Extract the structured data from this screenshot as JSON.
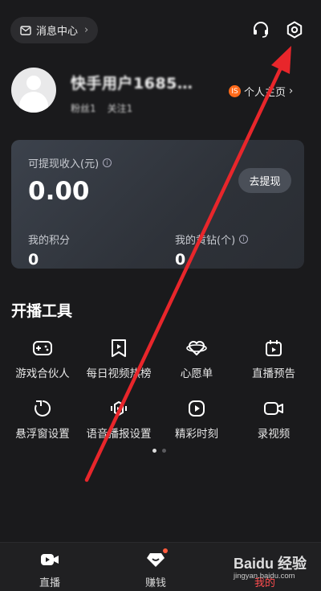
{
  "header": {
    "message_center": "消息中心",
    "message_chevron": "›",
    "icons": [
      "envelope-icon",
      "headset-icon",
      "settings-icon"
    ]
  },
  "profile": {
    "username": "快手用户1685…",
    "stats": [
      "粉丝1",
      "关注1"
    ],
    "homepage_label": "个人主页",
    "homepage_chevron": "›",
    "badge_text": "IS"
  },
  "wallet": {
    "income_label": "可提现收入(元)",
    "income_value": "0.00",
    "withdraw_label": "去提现",
    "points_label": "我的积分",
    "points_value": "0",
    "diamond_label": "我的黄钻(个)",
    "diamond_value": "0"
  },
  "tools": {
    "title": "开播工具",
    "items": [
      {
        "label": "游戏合伙人",
        "icon": "gamepad-icon"
      },
      {
        "label": "每日视频热榜",
        "icon": "bookmark-play-icon"
      },
      {
        "label": "心愿单",
        "icon": "heart-ring-icon"
      },
      {
        "label": "直播预告",
        "icon": "calendar-play-icon"
      },
      {
        "label": "悬浮窗设置",
        "icon": "floating-window-icon"
      },
      {
        "label": "语音播报设置",
        "icon": "voice-broadcast-icon"
      },
      {
        "label": "精彩时刻",
        "icon": "highlight-play-icon"
      },
      {
        "label": "录视频",
        "icon": "video-record-icon"
      }
    ],
    "page_indicator": {
      "current": 1,
      "total": 2
    }
  },
  "tabbar": {
    "items": [
      {
        "label": "直播",
        "icon": "live-camera-icon",
        "active": false
      },
      {
        "label": "赚钱",
        "icon": "diamond-icon",
        "active": false
      },
      {
        "label": "我的",
        "icon": "me-icon",
        "active": true
      }
    ]
  },
  "watermark": {
    "line1": "Baidu 经验",
    "line2": "jingyan.baidu.com"
  },
  "colors": {
    "background": "#1a1a1c",
    "accent_red": "#ff4d4f",
    "arrow_red": "#e8262b"
  }
}
